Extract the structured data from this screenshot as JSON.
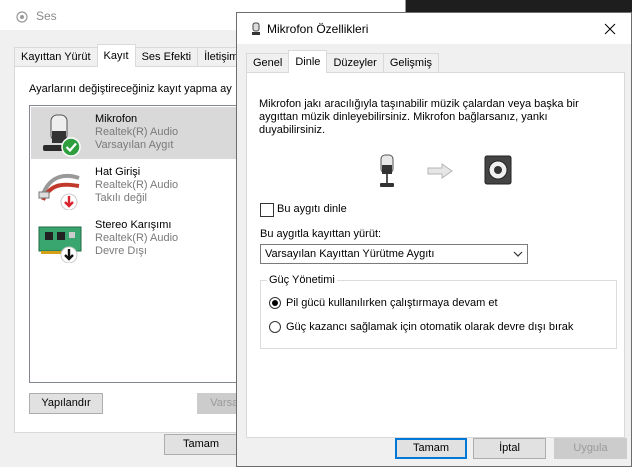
{
  "bg_window": {
    "title": "Ses",
    "tabs": [
      "Kayıttan Yürüt",
      "Kayıt",
      "Ses Efekti",
      "İletişim"
    ],
    "active_tab": "Kayıt",
    "instruction": "Ayarlarını değiştireceğiniz kayıt yapma ay",
    "devices": [
      {
        "name": "Mikrofon",
        "driver": "Realtek(R) Audio",
        "status": "Varsayılan Aygıt",
        "icon": "microphone-icon",
        "badge": "check-badge-icon"
      },
      {
        "name": "Hat Girişi",
        "driver": "Realtek(R) Audio",
        "status": "Takılı değil",
        "icon": "line-in-icon",
        "badge": "red-down-arrow-icon"
      },
      {
        "name": "Stereo Karışımı",
        "driver": "Realtek(R) Audio",
        "status": "Devre Dışı",
        "icon": "circuit-board-icon",
        "badge": "black-down-arrow-icon"
      }
    ],
    "configure_label": "Yapılandır",
    "set_default_label": "Varsay",
    "ok_label": "Tamam"
  },
  "dialog": {
    "title": "Mikrofon Özellikleri",
    "tabs": [
      "Genel",
      "Dinle",
      "Düzeyler",
      "Gelişmiş"
    ],
    "active_tab": "Dinle",
    "description": "Mikrofon jakı aracılığıyla taşınabilir müzik çalardan veya başka bir aygıttan müzik dinleyebilirsiniz. Mikrofon bağlarsanız, yankı duyabilirsiniz.",
    "listen_label": "Bu aygıtı dinle",
    "listen_checked": false,
    "playback_label": "Bu aygıtla kayıttan yürüt:",
    "playback_value": "Varsayılan Kayıttan Yürütme Aygıtı",
    "power_title": "Güç Yönetimi",
    "power_options": [
      "Pil gücü kullanılırken çalıştırmaya devam et",
      "Güç kazancı sağlamak için otomatik olarak devre dışı bırak"
    ],
    "power_selected": 0,
    "ok_label": "Tamam",
    "cancel_label": "İptal",
    "apply_label": "Uygula"
  },
  "colors": {
    "accent": "#0078d7",
    "selected_row": "#d9d9d9",
    "gray_text": "#7a7a7a"
  }
}
